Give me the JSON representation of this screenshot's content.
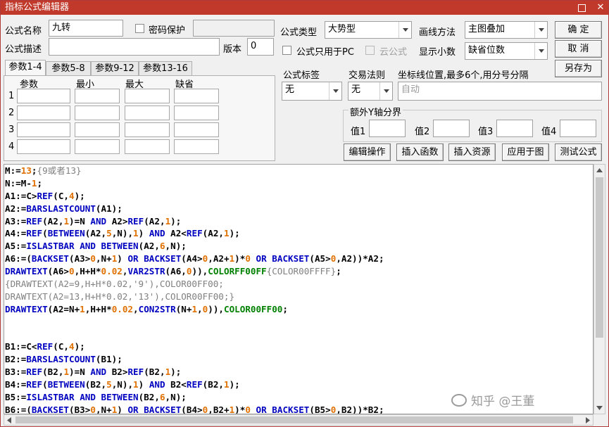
{
  "window": {
    "title": "指标公式编辑器",
    "minimize_glyph": "▭",
    "close_glyph": "✕"
  },
  "form": {
    "name_label": "公式名称",
    "name_value": "九转",
    "password_label": "密码保护",
    "desc_label": "公式描述",
    "desc_value": "",
    "version_label": "版本",
    "version_value": "0",
    "type_label": "公式类型",
    "type_value": "大势型",
    "draw_label": "画线方法",
    "draw_value": "主图叠加",
    "pc_only_label": "公式只用于PC",
    "cloud_label": "云公式",
    "decimals_label": "显示小数",
    "decimals_value": "缺省位数",
    "tag_label": "公式标签",
    "tag_value": "无",
    "trade_label": "交易法则",
    "trade_value": "无",
    "coord_label": "坐标线位置,最多6个,用分号分隔",
    "coord_value": "自动",
    "yaxis_group_label": "额外Y轴分界",
    "yaxis_labels": [
      "值1",
      "值2",
      "值3",
      "值4"
    ]
  },
  "buttons": {
    "ok": "确  定",
    "cancel": "取  消",
    "save_as": "另存为",
    "edit_ops": "编辑操作",
    "insert_func": "插入函数",
    "insert_res": "插入资源",
    "apply_chart": "应用于图",
    "test_formula": "测试公式"
  },
  "tabs": [
    "参数1-4",
    "参数5-8",
    "参数9-12",
    "参数13-16"
  ],
  "params": {
    "headers": [
      "参数",
      "最小",
      "最大",
      "缺省"
    ],
    "rows": [
      "1",
      "2",
      "3",
      "4"
    ]
  },
  "code_lines": [
    "M:=13;{9或者13}",
    "N:=M-1;",
    "A1:=C>REF(C,4);",
    "A2:=BARSLASTCOUNT(A1);",
    "A3:=REF(A2,1)=N AND A2>REF(A2,1);",
    "A4:=REF(BETWEEN(A2,5,N),1) AND A2<REF(A2,1);",
    "A5:=ISLASTBAR AND BETWEEN(A2,6,N);",
    "A6:=(BACKSET(A3>0,N+1) OR BACKSET(A4>0,A2+1)*0 OR BACKSET(A5>0,A2))*A2;",
    "DRAWTEXT(A6>0,H+H*0.02,VAR2STR(A6,0)),COLORFF00FF{COLOR00FFFF};",
    "{DRAWTEXT(A2=9,H+H*0.02,'9'),COLOR00FF00;",
    "DRAWTEXT(A2=13,H+H*0.02,'13'),COLOR00FF00;}",
    "DRAWTEXT(A2=N+1,H+H*0.02,CON2STR(N+1,0)),COLOR00FF00;",
    "",
    "",
    "B1:=C<REF(C,4);",
    "B2:=BARSLASTCOUNT(B1);",
    "B3:=REF(B2,1)=N AND B2>REF(B2,1);",
    "B4:=REF(BETWEEN(B2,5,N),1) AND B2<REF(B2,1);",
    "B5:=ISLASTBAR AND BETWEEN(B2,6,N);",
    "B6:=(BACKSET(B3>0,N+1) OR BACKSET(B4>0,B2+1)*0 OR BACKSET(B5>0,B2))*B2;"
  ],
  "watermark": "知乎 @王董",
  "colors": {
    "titlebar": "#c0392b",
    "keyword": "#0000c0",
    "number": "#e07000",
    "function": "#0000c0",
    "color_const": "#008000",
    "comment": "#808080"
  }
}
